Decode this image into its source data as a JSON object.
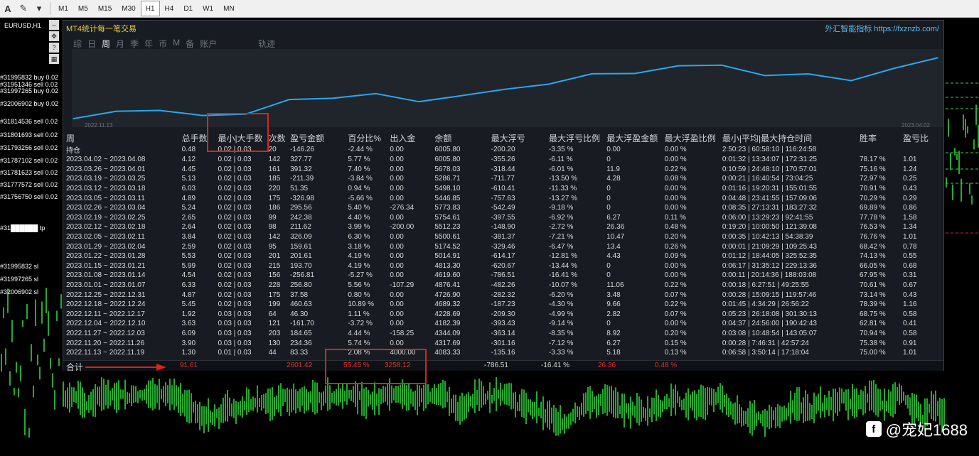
{
  "toolbar": {
    "icons": [
      "A",
      "✎",
      "▾"
    ],
    "timeframes": [
      {
        "label": "M1",
        "active": false
      },
      {
        "label": "M5",
        "active": false
      },
      {
        "label": "M15",
        "active": false
      },
      {
        "label": "M30",
        "active": false
      },
      {
        "label": "H1",
        "active": true
      },
      {
        "label": "H4",
        "active": false
      },
      {
        "label": "D1",
        "active": false
      },
      {
        "label": "W1",
        "active": false
      },
      {
        "label": "MN",
        "active": false
      }
    ]
  },
  "chart": {
    "symbol": "EURUSD,H1",
    "order_labels": [
      "#31995832 buy 0.02",
      "#31951346 sell 0.02",
      "#31997265 buy 0.02",
      "#32006902 buy 0.02",
      "#31814536 sell 0.02",
      "#31801693 sell 0.02",
      "#31793256 sell 0.02",
      "#31787102 sell 0.02",
      "#31781623 sell 0.02",
      "#31777572 sell 0.02",
      "#31756750 sell 0.02",
      "#31██████ tp",
      "#31995832 sl",
      "#31997265 sl",
      "#32006902 sl"
    ]
  },
  "panel": {
    "title": "MT4统计每一笔交易",
    "brand": "外汇智能指标 https://fxznzb.com/",
    "tabs": [
      {
        "label": "综",
        "active": false
      },
      {
        "label": "日",
        "active": false
      },
      {
        "label": "周",
        "active": true
      },
      {
        "label": "月",
        "active": false
      },
      {
        "label": "季",
        "active": false
      },
      {
        "label": "年",
        "active": false
      },
      {
        "label": "币",
        "active": false
      },
      {
        "label": "M",
        "active": false
      },
      {
        "label": "备",
        "active": false
      },
      {
        "label": "账户",
        "active": false
      },
      {
        "label": "轨迹",
        "active": false
      }
    ],
    "curve": {
      "start_date": "2022.11.13",
      "end_date": "2023.04.02",
      "balance": [
        4083.33,
        4317.69,
        4344.09,
        4182.39,
        4228.69,
        4689.32,
        4726.9,
        4876.41,
        4619.6,
        4813.3,
        5014.91,
        5174.52,
        5500.61,
        5512.23,
        5754.61,
        5773.83,
        5446.85,
        5498.1,
        5286.71,
        5678.03,
        6005.8
      ]
    },
    "headers": [
      "周",
      "总手数",
      "最小|大手数",
      "次数",
      "盈亏金额",
      "百分比%",
      "出入金",
      "余额",
      "最大浮亏",
      "最大浮亏比例",
      "最大浮盈金额",
      "最大浮盈比例",
      "最小|平均|最大持仓时间",
      "胜率",
      "盈亏比"
    ],
    "holding_row": {
      "label": "持仓",
      "lots": "0.48",
      "minmax": "0.02 | 0.03",
      "count": "20",
      "pl": "-146.26",
      "pct": "-2.44 %",
      "deposit": "0.00",
      "balance": "6005.80",
      "max_dd": "-200.20",
      "max_dd_pct": "-3.35 %",
      "max_fp": "0.00",
      "max_fp_pct": "0.00 %",
      "hold_time": "2:50:23 | 60:58:10 | 116:24:58",
      "win": "",
      "ratio": ""
    },
    "rows": [
      {
        "label": "2023.04.02 ~ 2023.04.08",
        "lots": "4.12",
        "minmax": "0.02 | 0.03",
        "count": "142",
        "pl": "327.77",
        "pct": "5.77 %",
        "deposit": "0.00",
        "balance": "6005.80",
        "max_dd": "-355.26",
        "max_dd_pct": "-6.11 %",
        "max_fp": "0",
        "max_fp_pct": "0.00 %",
        "hold_time": "0:01:32 | 13:34:07 | 172:31:25",
        "win": "78.17 %",
        "ratio": "1.01",
        "sign": "neg"
      },
      {
        "label": "2023.03.26 ~ 2023.04.01",
        "lots": "4.45",
        "minmax": "0.02 | 0.03",
        "count": "161",
        "pl": "391.32",
        "pct": "7.40 %",
        "deposit": "0.00",
        "balance": "5678.03",
        "max_dd": "-318.44",
        "max_dd_pct": "-6.01 %",
        "max_fp": "11.9",
        "max_fp_pct": "0.22 %",
        "hold_time": "0:10:59 | 24:48:10 | 170:57:01",
        "win": "75.16 %",
        "ratio": "1.24",
        "sign": "neg"
      },
      {
        "label": "2023.03.19 ~ 2023.03.25",
        "lots": "5.13",
        "minmax": "0.02 | 0.03",
        "count": "185",
        "pl": "-211.39",
        "pct": "-3.84 %",
        "deposit": "0.00",
        "balance": "5286.71",
        "max_dd": "-711.77",
        "max_dd_pct": "-13.50 %",
        "max_fp": "4.28",
        "max_fp_pct": "0.08 %",
        "hold_time": "0:00:21 | 16:40:54 | 73:04:25",
        "win": "72.97 %",
        "ratio": "0.25",
        "sign": "pos"
      },
      {
        "label": "2023.03.12 ~ 2023.03.18",
        "lots": "6.03",
        "minmax": "0.02 | 0.03",
        "count": "220",
        "pl": "51.35",
        "pct": "0.94 %",
        "deposit": "0.00",
        "balance": "5498.10",
        "max_dd": "-610.41",
        "max_dd_pct": "-11.33 %",
        "max_fp": "0",
        "max_fp_pct": "0.00 %",
        "hold_time": "0:01:16 | 19:20:31 | 155:01:55",
        "win": "70.91 %",
        "ratio": "0.43",
        "sign": "neg"
      },
      {
        "label": "2023.03.05 ~ 2023.03.11",
        "lots": "4.89",
        "minmax": "0.02 | 0.03",
        "count": "175",
        "pl": "-326.98",
        "pct": "-5.66 %",
        "deposit": "0.00",
        "balance": "5446.85",
        "max_dd": "-757.63",
        "max_dd_pct": "-13.27 %",
        "max_fp": "0",
        "max_fp_pct": "0.00 %",
        "hold_time": "0:04:48 | 23:41:55 | 157:09:06",
        "win": "70.29 %",
        "ratio": "0.29",
        "sign": "pos"
      },
      {
        "label": "2023.02.26 ~ 2023.03.04",
        "lots": "5.24",
        "minmax": "0.02 | 0.03",
        "count": "186",
        "pl": "295.56",
        "pct": "5.40 %",
        "deposit": "-276.34",
        "balance": "5773.83",
        "max_dd": "-542.49",
        "max_dd_pct": "-9.18 %",
        "max_fp": "0",
        "max_fp_pct": "0.00 %",
        "hold_time": "0:08:35 | 27:13:31 | 183:27:32",
        "win": "69.89 %",
        "ratio": "0.86",
        "sign": "neg"
      },
      {
        "label": "2023.02.19 ~ 2023.02.25",
        "lots": "2.65",
        "minmax": "0.02 | 0.03",
        "count": "99",
        "pl": "242.38",
        "pct": "4.40 %",
        "deposit": "0.00",
        "balance": "5754.61",
        "max_dd": "-397.55",
        "max_dd_pct": "-6.92 %",
        "max_fp": "6.27",
        "max_fp_pct": "0.11 %",
        "hold_time": "0:06:00 | 13:29:23 | 92:41:55",
        "win": "77.78 %",
        "ratio": "1.58",
        "sign": "neg"
      },
      {
        "label": "2023.02.12 ~ 2023.02.18",
        "lots": "2.64",
        "minmax": "0.02 | 0.03",
        "count": "98",
        "pl": "211.62",
        "pct": "3.99 %",
        "deposit": "-200.00",
        "balance": "5512.23",
        "max_dd": "-148.90",
        "max_dd_pct": "-2.72 %",
        "max_fp": "26.36",
        "max_fp_pct": "0.48 %",
        "hold_time": "0:19:20 | 10:00:50 | 121:39:08",
        "win": "76.53 %",
        "ratio": "1.34",
        "sign": "neg"
      },
      {
        "label": "2023.02.05 ~ 2023.02.11",
        "lots": "3.84",
        "minmax": "0.02 | 0.03",
        "count": "142",
        "pl": "326.09",
        "pct": "6.30 %",
        "deposit": "0.00",
        "balance": "5500.61",
        "max_dd": "-381.37",
        "max_dd_pct": "-7.21 %",
        "max_fp": "10.47",
        "max_fp_pct": "0.20 %",
        "hold_time": "0:00:35 | 10:42:13 | 54:38:39",
        "win": "76.76 %",
        "ratio": "1.01",
        "sign": "neg"
      },
      {
        "label": "2023.01.29 ~ 2023.02.04",
        "lots": "2.59",
        "minmax": "0.02 | 0.03",
        "count": "95",
        "pl": "159.61",
        "pct": "3.18 %",
        "deposit": "0.00",
        "balance": "5174.52",
        "max_dd": "-329.46",
        "max_dd_pct": "-6.47 %",
        "max_fp": "13.4",
        "max_fp_pct": "0.26 %",
        "hold_time": "0:00:01 | 21:09:29 | 109:25:43",
        "win": "68.42 %",
        "ratio": "0.78",
        "sign": "neg"
      },
      {
        "label": "2023.01.22 ~ 2023.01.28",
        "lots": "5.53",
        "minmax": "0.02 | 0.03",
        "count": "201",
        "pl": "201.61",
        "pct": "4.19 %",
        "deposit": "0.00",
        "balance": "5014.91",
        "max_dd": "-614.17",
        "max_dd_pct": "-12.81 %",
        "max_fp": "4.43",
        "max_fp_pct": "0.09 %",
        "hold_time": "0:01:12 | 18:44:05 | 325:52:35",
        "win": "74.13 %",
        "ratio": "0.55",
        "sign": "neg"
      },
      {
        "label": "2023.01.15 ~ 2023.01.21",
        "lots": "5.99",
        "minmax": "0.02 | 0.03",
        "count": "215",
        "pl": "193.70",
        "pct": "4.19 %",
        "deposit": "0.00",
        "balance": "4813.30",
        "max_dd": "-620.67",
        "max_dd_pct": "-13.44 %",
        "max_fp": "0",
        "max_fp_pct": "0.00 %",
        "hold_time": "0:06:17 | 31:35:12 | 229:13:36",
        "win": "66.05 %",
        "ratio": "0.68",
        "sign": "neg"
      },
      {
        "label": "2023.01.08 ~ 2023.01.14",
        "lots": "4.54",
        "minmax": "0.02 | 0.03",
        "count": "156",
        "pl": "-256.81",
        "pct": "-5.27 %",
        "deposit": "0.00",
        "balance": "4619.60",
        "max_dd": "-786.51",
        "max_dd_pct": "-16.41 %",
        "max_fp": "0",
        "max_fp_pct": "0.00 %",
        "hold_time": "0:00:11 | 20:14:36 | 188:03:08",
        "win": "67.95 %",
        "ratio": "0.31",
        "sign": "pos"
      },
      {
        "label": "2023.01.01 ~ 2023.01.07",
        "lots": "6.33",
        "minmax": "0.02 | 0.03",
        "count": "228",
        "pl": "256.80",
        "pct": "5.56 %",
        "deposit": "-107.29",
        "balance": "4876.41",
        "max_dd": "-482.26",
        "max_dd_pct": "-10.07 %",
        "max_fp": "11.06",
        "max_fp_pct": "0.22 %",
        "hold_time": "0:00:18 | 6:27:51 | 49:25:55",
        "win": "70.61 %",
        "ratio": "0.67",
        "sign": "neg"
      },
      {
        "label": "2022.12.25 ~ 2022.12.31",
        "lots": "4.87",
        "minmax": "0.02 | 0.03",
        "count": "175",
        "pl": "37.58",
        "pct": "0.80 %",
        "deposit": "0.00",
        "balance": "4726.90",
        "max_dd": "-282.32",
        "max_dd_pct": "-6.20 %",
        "max_fp": "3.48",
        "max_fp_pct": "0.07 %",
        "hold_time": "0:00:28 | 15:09:15 | 119:57:46",
        "win": "73.14 %",
        "ratio": "0.43",
        "sign": "neg"
      },
      {
        "label": "2022.12.18 ~ 2022.12.24",
        "lots": "5.45",
        "minmax": "0.02 | 0.03",
        "count": "199",
        "pl": "460.63",
        "pct": "10.89 %",
        "deposit": "0.00",
        "balance": "4689.32",
        "max_dd": "-187.23",
        "max_dd_pct": "-4.30 %",
        "max_fp": "9.66",
        "max_fp_pct": "0.22 %",
        "hold_time": "0:01:45 | 4:34:29 | 26:56:22",
        "win": "78.39 %",
        "ratio": "1.16",
        "sign": "neg"
      },
      {
        "label": "2022.12.11 ~ 2022.12.17",
        "lots": "1.92",
        "minmax": "0.03 | 0.03",
        "count": "64",
        "pl": "46.30",
        "pct": "1.11 %",
        "deposit": "0.00",
        "balance": "4228.69",
        "max_dd": "-209.30",
        "max_dd_pct": "-4.99 %",
        "max_fp": "2.82",
        "max_fp_pct": "0.07 %",
        "hold_time": "0:05:23 | 26:18:08 | 301:30:13",
        "win": "68.75 %",
        "ratio": "0.58",
        "sign": "neg"
      },
      {
        "label": "2022.12.04 ~ 2022.12.10",
        "lots": "3.63",
        "minmax": "0.03 | 0.03",
        "count": "121",
        "pl": "-161.70",
        "pct": "-3.72 %",
        "deposit": "0.00",
        "balance": "4182.39",
        "max_dd": "-393.43",
        "max_dd_pct": "-9.14 %",
        "max_fp": "0",
        "max_fp_pct": "0.00 %",
        "hold_time": "0:04:37 | 24:56:00 | 190:42:43",
        "win": "62.81 %",
        "ratio": "0.41",
        "sign": "pos"
      },
      {
        "label": "2022.11.27 ~ 2022.12.03",
        "lots": "6.09",
        "minmax": "0.03 | 0.03",
        "count": "203",
        "pl": "184.65",
        "pct": "4.44 %",
        "deposit": "-158.25",
        "balance": "4344.09",
        "max_dd": "-363.14",
        "max_dd_pct": "-8.35 %",
        "max_fp": "8.92",
        "max_fp_pct": "0.20 %",
        "hold_time": "0:03:08 | 10:48:54 | 143:05:07",
        "win": "70.94 %",
        "ratio": "0.58",
        "sign": "neg"
      },
      {
        "label": "2022.11.20 ~ 2022.11.26",
        "lots": "3.90",
        "minmax": "0.03 | 0.03",
        "count": "130",
        "pl": "234.36",
        "pct": "5.74 %",
        "deposit": "0.00",
        "balance": "4317.69",
        "max_dd": "-301.16",
        "max_dd_pct": "-7.12 %",
        "max_fp": "6.27",
        "max_fp_pct": "0.15 %",
        "hold_time": "0:00:28 | 7:46:31 | 42:57:24",
        "win": "75.38 %",
        "ratio": "0.91",
        "sign": "neg"
      },
      {
        "label": "2022.11.13 ~ 2022.11.19",
        "lots": "1.30",
        "minmax": "0.01 | 0.03",
        "count": "44",
        "pl": "83.33",
        "pct": "2.08 %",
        "deposit": "4000.00",
        "balance": "4083.33",
        "max_dd": "-135.16",
        "max_dd_pct": "-3.33 %",
        "max_fp": "5.18",
        "max_fp_pct": "0.13 %",
        "hold_time": "0:06:58 | 3:50:14 | 17:18:04",
        "win": "75.00 %",
        "ratio": "1.01",
        "sign": "neg"
      }
    ],
    "total": {
      "label": "合计",
      "lots": "91.61",
      "pl": "2601.42",
      "pct": "55.45 %",
      "deposit": "3258.12",
      "max_dd": "-786.51",
      "max_dd_pct": "-16.41 %",
      "max_fp": "26.36",
      "max_fp_pct": "0.48 %"
    }
  },
  "watermark": {
    "text": "@宠妃1688"
  },
  "colors": {
    "profit_text": "#e4312b",
    "loss_text": "#4be35d",
    "curve": "#29a8ec",
    "title": "#e8c84a"
  }
}
